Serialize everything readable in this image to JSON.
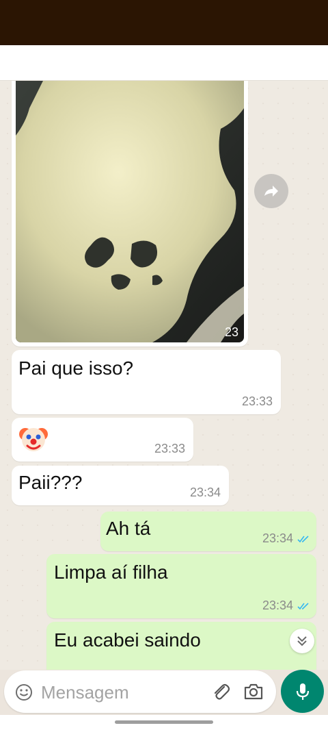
{
  "messages": [
    {
      "kind": "image",
      "direction": "incoming",
      "time": "23"
    },
    {
      "kind": "text",
      "direction": "incoming",
      "text": "Pai que isso?",
      "time": "23:33"
    },
    {
      "kind": "emoji",
      "direction": "incoming",
      "emoji": "clown-face-icon",
      "time": "23:33"
    },
    {
      "kind": "text",
      "direction": "incoming",
      "text": "Paii???",
      "time": "23:34"
    },
    {
      "kind": "text",
      "direction": "outgoing",
      "text": "Ah tá",
      "time": "23:34",
      "status": "read"
    },
    {
      "kind": "text",
      "direction": "outgoing",
      "text": "Limpa aí filha",
      "time": "23:34",
      "status": "read"
    },
    {
      "kind": "text",
      "direction": "outgoing",
      "text": "Eu acabei saindo",
      "time": "",
      "status": ""
    }
  ],
  "composer": {
    "placeholder": "Mensagem",
    "icons": [
      "emoji-icon",
      "attach-icon",
      "camera-icon",
      "mic-icon"
    ]
  },
  "actions": {
    "forward_icon": "forward-icon",
    "scroll_icon": "double-chevron-down-icon"
  },
  "colors": {
    "status_bar": "#2b1503",
    "chat_bg": "#efeae2",
    "incoming_bubble": "#ffffff",
    "outgoing_bubble": "#dcf8c6",
    "read_ticks": "#34b7f1",
    "mic_button": "#00866f"
  }
}
